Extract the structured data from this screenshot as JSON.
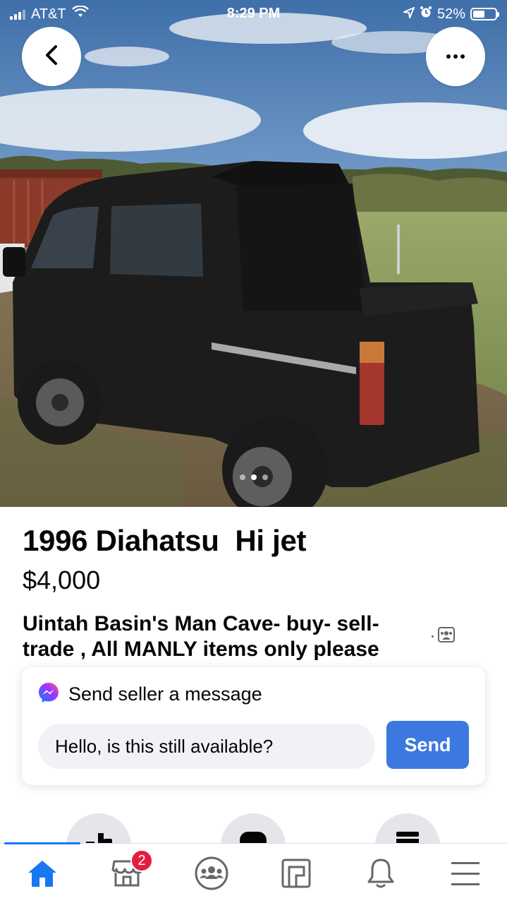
{
  "status_bar": {
    "carrier": "AT&T",
    "time": "8:29 PM",
    "battery": "52%",
    "battery_level": 0.52,
    "icons": [
      "signal-icon",
      "wifi-icon",
      "location-icon",
      "alarm-icon",
      "battery-icon"
    ]
  },
  "header": {
    "back_icon": "chevron-left-icon",
    "more_icon": "more-horizontal-icon"
  },
  "photo": {
    "image_count": 3,
    "active_index": 1
  },
  "listing": {
    "title": "1996 Diahatsu  Hi jet",
    "price": "$4,000",
    "group": "Uintah Basin's  Man Cave- buy- sell- trade , All MANLY items only please",
    "group_icon": "group-icon"
  },
  "message": {
    "heading": "Send seller a message",
    "heading_icon": "messenger-icon",
    "input_value": "Hello, is this still available?",
    "send_label": "Send"
  },
  "actions": [
    {
      "icon": "like-icon"
    },
    {
      "icon": "message-icon"
    },
    {
      "icon": "bookmark-icon"
    }
  ],
  "tab_bar": {
    "active": "home",
    "tabs": [
      {
        "id": "home",
        "icon": "home-icon"
      },
      {
        "id": "marketplace",
        "icon": "marketplace-icon",
        "badge": "2"
      },
      {
        "id": "groups",
        "icon": "groups-icon"
      },
      {
        "id": "pages",
        "icon": "pages-icon"
      },
      {
        "id": "notifications",
        "icon": "bell-icon"
      },
      {
        "id": "menu",
        "icon": "menu-icon"
      }
    ]
  },
  "colors": {
    "accent": "#1877f2",
    "send_button": "#3b78e0",
    "badge": "#e41e3f",
    "input_bg": "#f0f2f5",
    "icon_gray": "#65676b"
  }
}
